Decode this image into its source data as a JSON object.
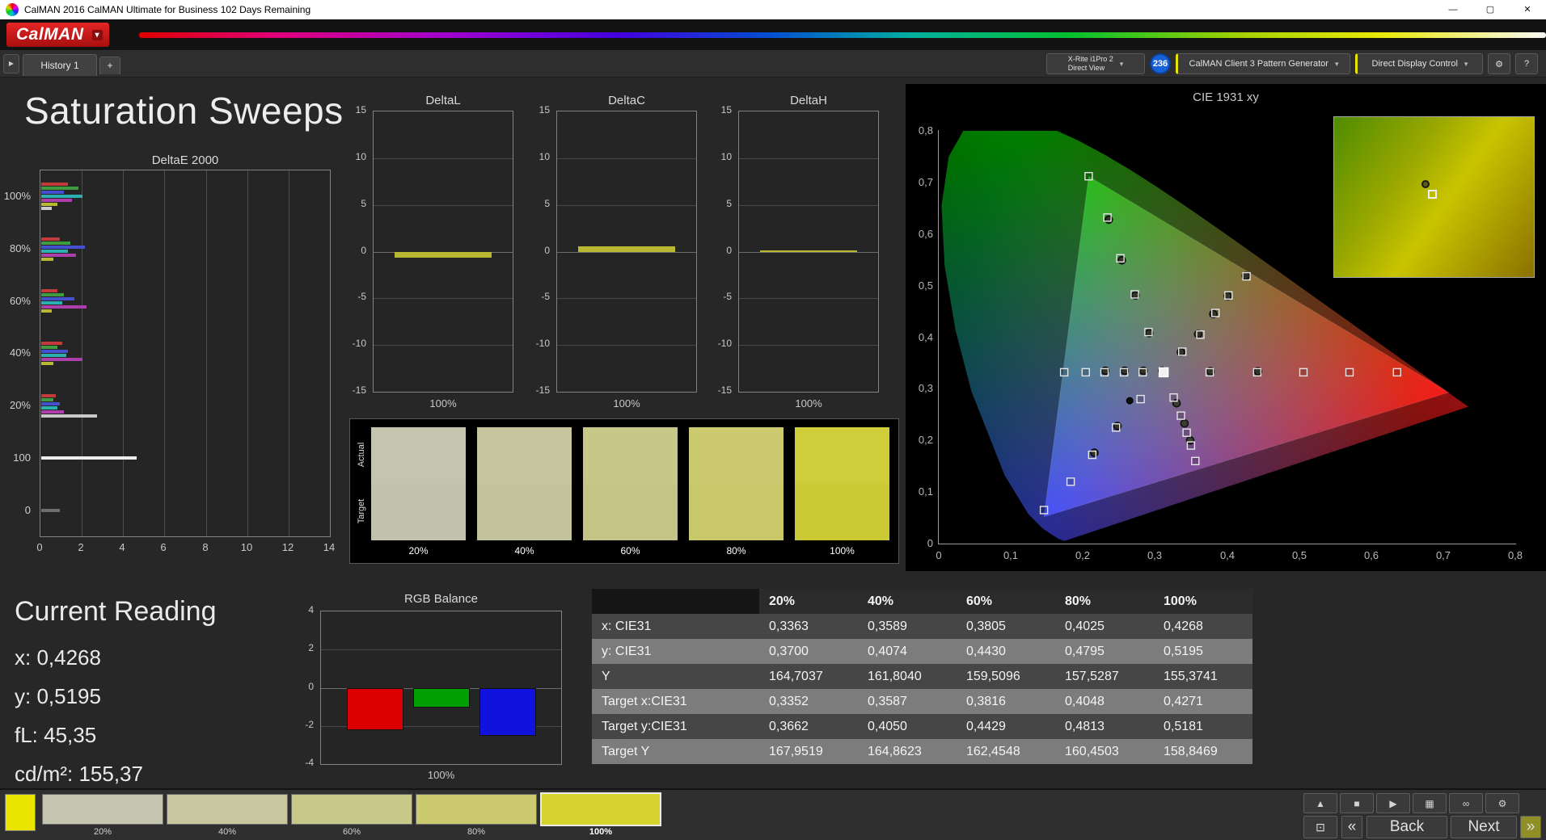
{
  "window": {
    "title": "CalMAN 2016 CalMAN Ultimate for Business 102 Days Remaining",
    "minimize": "—",
    "maximize": "▢",
    "close": "✕"
  },
  "brand": {
    "logo": "CalMAN",
    "caret": "▾"
  },
  "tabbar": {
    "expand": "▶",
    "history_tab": "History 1",
    "add_tab": "+",
    "meter_line1": "X-Rite i1Pro 2",
    "meter_line2": "Direct View",
    "meter_badge": "236",
    "pattern_generator": "CalMAN Client 3 Pattern Generator",
    "display_control": "Direct Display Control",
    "gear": "⚙",
    "help": "?",
    "caret": "▾"
  },
  "page": {
    "title": "Saturation Sweeps"
  },
  "current_reading": {
    "title": "Current Reading",
    "lines": [
      "x: 0,4268",
      "y: 0,5195",
      "fL: 45,35",
      "cd/m²: 155,37"
    ]
  },
  "bottom_bar": {
    "current_patch_color": "#ebe600",
    "swatches": [
      {
        "label": "20%",
        "color": "#c6c5b0",
        "selected": false
      },
      {
        "label": "40%",
        "color": "#c7c69f",
        "selected": false
      },
      {
        "label": "60%",
        "color": "#c9c88b",
        "selected": false
      },
      {
        "label": "80%",
        "color": "#ccca6f",
        "selected": false
      },
      {
        "label": "100%",
        "color": "#d6d32f",
        "selected": true
      }
    ],
    "transport": [
      {
        "name": "collapse-button",
        "glyph": "▲"
      },
      {
        "name": "stop-button",
        "glyph": "■"
      },
      {
        "name": "play-button",
        "glyph": "▶"
      },
      {
        "name": "pattern-window-button",
        "glyph": "▦"
      },
      {
        "name": "continuous-read-button",
        "glyph": "∞"
      },
      {
        "name": "options-button",
        "glyph": "⚙"
      }
    ],
    "layout_glyph": "⊡",
    "back_chevron": "«",
    "back_label": "Back",
    "next_label": "Next",
    "next_chevron": "»"
  },
  "chart_data": [
    {
      "id": "deltae2000",
      "type": "bar",
      "orientation": "horizontal",
      "title": "DeltaE 2000",
      "xlim": [
        0,
        14
      ],
      "xticks": [
        "0",
        "2",
        "4",
        "6",
        "8",
        "10",
        "12",
        "14"
      ],
      "groups": [
        {
          "label": "100%",
          "bars": [
            {
              "color": "#c23a3a",
              "value": 1.3
            },
            {
              "color": "#3f9b3f",
              "value": 1.8
            },
            {
              "color": "#4450cf",
              "value": 1.1
            },
            {
              "color": "#2ab0b0",
              "value": 2.0
            },
            {
              "color": "#ad3fad",
              "value": 1.5
            },
            {
              "color": "#b9b931",
              "value": 0.8
            },
            {
              "color": "#cccccc",
              "value": 0.5
            }
          ]
        },
        {
          "label": "80%",
          "bars": [
            {
              "color": "#c23a3a",
              "value": 0.9
            },
            {
              "color": "#3f9b3f",
              "value": 1.4
            },
            {
              "color": "#4450cf",
              "value": 2.1
            },
            {
              "color": "#2ab0b0",
              "value": 1.3
            },
            {
              "color": "#ad3fad",
              "value": 1.7
            },
            {
              "color": "#b9b931",
              "value": 0.6
            }
          ]
        },
        {
          "label": "60%",
          "bars": [
            {
              "color": "#c23a3a",
              "value": 0.8
            },
            {
              "color": "#3f9b3f",
              "value": 1.1
            },
            {
              "color": "#4450cf",
              "value": 1.6
            },
            {
              "color": "#2ab0b0",
              "value": 1.0
            },
            {
              "color": "#ad3fad",
              "value": 2.2
            },
            {
              "color": "#b9b931",
              "value": 0.5
            }
          ]
        },
        {
          "label": "40%",
          "bars": [
            {
              "color": "#c23a3a",
              "value": 1.0
            },
            {
              "color": "#3f9b3f",
              "value": 0.8
            },
            {
              "color": "#4450cf",
              "value": 1.3
            },
            {
              "color": "#2ab0b0",
              "value": 1.2
            },
            {
              "color": "#ad3fad",
              "value": 2.0
            },
            {
              "color": "#b9b931",
              "value": 0.6
            }
          ]
        },
        {
          "label": "20%",
          "bars": [
            {
              "color": "#c23a3a",
              "value": 0.7
            },
            {
              "color": "#3f9b3f",
              "value": 0.6
            },
            {
              "color": "#4450cf",
              "value": 0.9
            },
            {
              "color": "#2ab0b0",
              "value": 0.8
            },
            {
              "color": "#ad3fad",
              "value": 1.1
            },
            {
              "color": "#c9c9c9",
              "value": 2.7
            }
          ]
        },
        {
          "label": "100",
          "bars": [
            {
              "color": "#ededed",
              "value": 4.6
            }
          ]
        },
        {
          "label": "0",
          "bars": [
            {
              "color": "#6f6f6f",
              "value": 0.9
            }
          ]
        }
      ]
    },
    {
      "id": "deltaL",
      "type": "bar",
      "title": "DeltaL",
      "ylim": [
        -15,
        15
      ],
      "yticks": [
        "15",
        "10",
        "5",
        "0",
        "-5",
        "-10",
        "-15"
      ],
      "xlabel": "100%",
      "values": [
        -0.6
      ],
      "bar_color": "#b9b931"
    },
    {
      "id": "deltaC",
      "type": "bar",
      "title": "DeltaC",
      "ylim": [
        -15,
        15
      ],
      "yticks": [
        "15",
        "10",
        "5",
        "0",
        "-5",
        "-10",
        "-15"
      ],
      "xlabel": "100%",
      "values": [
        0.6
      ],
      "bar_color": "#b9b931"
    },
    {
      "id": "deltaH",
      "type": "bar",
      "title": "DeltaH",
      "ylim": [
        -15,
        15
      ],
      "yticks": [
        "15",
        "10",
        "5",
        "0",
        "-5",
        "-10",
        "-15"
      ],
      "xlabel": "100%",
      "values": [
        0.15
      ],
      "bar_color": "#b9b931"
    },
    {
      "id": "rgb_balance",
      "type": "bar",
      "title": "RGB Balance",
      "ylim": [
        -4,
        4
      ],
      "yticks": [
        "4",
        "2",
        "0",
        "-2",
        "-4"
      ],
      "xlabel": "100%",
      "series": [
        {
          "name": "Red",
          "color": "#dd0000",
          "value": -2.2
        },
        {
          "name": "Green",
          "color": "#00a000",
          "value": -1.0
        },
        {
          "name": "Blue",
          "color": "#1212dd",
          "value": -2.5
        }
      ]
    },
    {
      "id": "cie1931",
      "type": "scatter",
      "title": "CIE 1931 xy",
      "xlim": [
        0,
        0.8
      ],
      "ylim": [
        0,
        0.8
      ],
      "xticks": [
        "0",
        "0,1",
        "0,2",
        "0,3",
        "0,4",
        "0,5",
        "0,6",
        "0,7",
        "0,8"
      ],
      "yticks": [
        "0",
        "0,1",
        "0,2",
        "0,3",
        "0,4",
        "0,5",
        "0,6",
        "0,7",
        "0,8"
      ],
      "spectral_locus": [
        [
          0.1741,
          0.005
        ],
        [
          0.1666,
          0.0089
        ],
        [
          0.1566,
          0.0177
        ],
        [
          0.144,
          0.0297
        ],
        [
          0.1241,
          0.0578
        ],
        [
          0.0913,
          0.1327
        ],
        [
          0.0454,
          0.295
        ],
        [
          0.0235,
          0.4127
        ],
        [
          0.0082,
          0.5384
        ],
        [
          0.0039,
          0.6548
        ],
        [
          0.0139,
          0.7502
        ],
        [
          0.0389,
          0.812
        ],
        [
          0.0743,
          0.8338
        ],
        [
          0.1142,
          0.8262
        ],
        [
          0.1547,
          0.8059
        ],
        [
          0.1929,
          0.7816
        ],
        [
          0.2296,
          0.7543
        ],
        [
          0.2658,
          0.7243
        ],
        [
          0.3016,
          0.6923
        ],
        [
          0.3373,
          0.6589
        ],
        [
          0.3731,
          0.6245
        ],
        [
          0.4087,
          0.5896
        ],
        [
          0.4441,
          0.5547
        ],
        [
          0.4788,
          0.5202
        ],
        [
          0.5125,
          0.4866
        ],
        [
          0.5448,
          0.4544
        ],
        [
          0.5752,
          0.4242
        ],
        [
          0.6029,
          0.3965
        ],
        [
          0.627,
          0.3725
        ],
        [
          0.6482,
          0.3514
        ],
        [
          0.6658,
          0.334
        ],
        [
          0.6915,
          0.3083
        ],
        [
          0.7079,
          0.292
        ],
        [
          0.719,
          0.2809
        ],
        [
          0.7347,
          0.2653
        ]
      ],
      "gamut_triangle": [
        [
          0.208,
          0.712
        ],
        [
          0.146,
          0.052
        ],
        [
          0.708,
          0.293
        ]
      ],
      "target_points": [
        [
          0.376,
          0.332
        ],
        [
          0.442,
          0.332
        ],
        [
          0.506,
          0.332
        ],
        [
          0.57,
          0.332
        ],
        [
          0.636,
          0.332
        ],
        [
          0.283,
          0.332
        ],
        [
          0.257,
          0.332
        ],
        [
          0.23,
          0.332
        ],
        [
          0.204,
          0.332
        ],
        [
          0.174,
          0.332
        ],
        [
          0.291,
          0.41
        ],
        [
          0.272,
          0.483
        ],
        [
          0.252,
          0.553
        ],
        [
          0.234,
          0.632
        ],
        [
          0.208,
          0.712
        ],
        [
          0.338,
          0.372
        ],
        [
          0.363,
          0.405
        ],
        [
          0.384,
          0.447
        ],
        [
          0.402,
          0.481
        ],
        [
          0.427,
          0.518
        ],
        [
          0.28,
          0.28
        ],
        [
          0.246,
          0.225
        ],
        [
          0.213,
          0.172
        ],
        [
          0.183,
          0.12
        ],
        [
          0.146,
          0.065
        ],
        [
          0.326,
          0.283
        ],
        [
          0.336,
          0.248
        ],
        [
          0.344,
          0.215
        ],
        [
          0.35,
          0.19
        ],
        [
          0.356,
          0.16
        ]
      ],
      "measured_points": [
        [
          0.336,
          0.371
        ],
        [
          0.36,
          0.406
        ],
        [
          0.381,
          0.445
        ],
        [
          0.401,
          0.48
        ],
        [
          0.426,
          0.519
        ],
        [
          0.231,
          0.335
        ],
        [
          0.258,
          0.335
        ],
        [
          0.284,
          0.335
        ],
        [
          0.31,
          0.335
        ],
        [
          0.377,
          0.334
        ],
        [
          0.443,
          0.334
        ],
        [
          0.236,
          0.628
        ],
        [
          0.254,
          0.549
        ],
        [
          0.273,
          0.481
        ],
        [
          0.292,
          0.408
        ],
        [
          0.33,
          0.272
        ],
        [
          0.341,
          0.233
        ],
        [
          0.349,
          0.2
        ],
        [
          0.248,
          0.228
        ],
        [
          0.216,
          0.176
        ]
      ],
      "highlight_point": [
        0.312,
        0.332
      ],
      "dot_point": [
        0.265,
        0.277
      ]
    },
    {
      "id": "saturation_swatches",
      "type": "table",
      "row_labels": [
        "Actual",
        "Target"
      ],
      "columns": [
        "20%",
        "40%",
        "60%",
        "80%",
        "100%"
      ],
      "actual_colors": [
        "#c5c4af",
        "#c6c59e",
        "#c8c78a",
        "#cbca6e",
        "#cfcd3a"
      ],
      "target_colors": [
        "#c2c1ac",
        "#c3c29b",
        "#c5c487",
        "#c8c76a",
        "#ccca34"
      ]
    },
    {
      "id": "results_table",
      "type": "table",
      "columns": [
        "",
        "20%",
        "40%",
        "60%",
        "80%",
        "100%"
      ],
      "rows": [
        {
          "label": "x: CIE31",
          "values": [
            "0,3363",
            "0,3589",
            "0,3805",
            "0,4025",
            "0,4268"
          ]
        },
        {
          "label": "y: CIE31",
          "values": [
            "0,3700",
            "0,4074",
            "0,4430",
            "0,4795",
            "0,5195"
          ]
        },
        {
          "label": "Y",
          "values": [
            "164,7037",
            "161,8040",
            "159,5096",
            "157,5287",
            "155,3741"
          ]
        },
        {
          "label": "Target x:CIE31",
          "values": [
            "0,3352",
            "0,3587",
            "0,3816",
            "0,4048",
            "0,4271"
          ]
        },
        {
          "label": "Target y:CIE31",
          "values": [
            "0,3662",
            "0,4050",
            "0,4429",
            "0,4813",
            "0,5181"
          ]
        },
        {
          "label": "Target Y",
          "values": [
            "167,9519",
            "164,8623",
            "162,4548",
            "160,4503",
            "158,8469"
          ]
        }
      ]
    }
  ]
}
